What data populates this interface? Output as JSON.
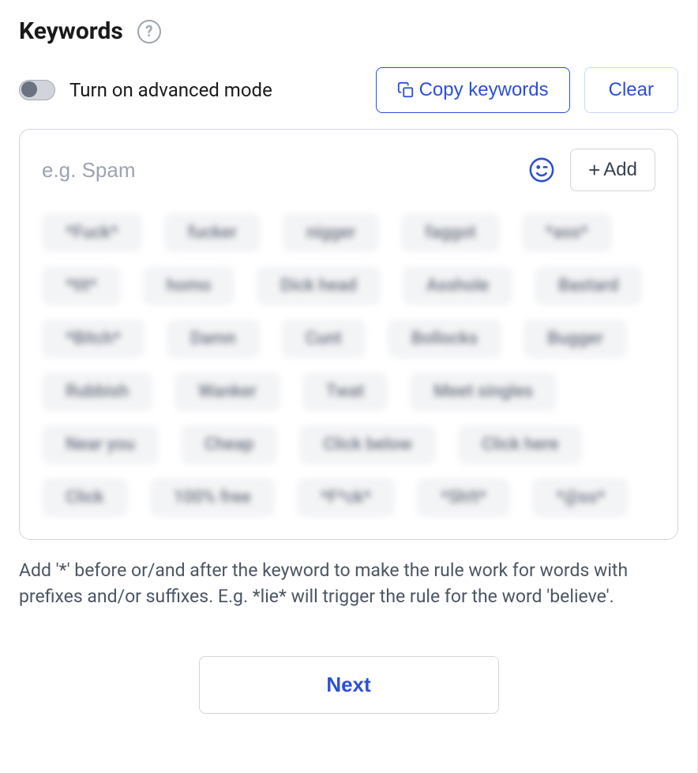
{
  "header": {
    "title": "Keywords",
    "help_glyph": "?"
  },
  "toggle": {
    "label": "Turn on advanced mode",
    "on": false
  },
  "actions": {
    "copy_label": "Copy keywords",
    "clear_label": "Clear"
  },
  "input": {
    "placeholder": "e.g. Spam",
    "add_label": "Add"
  },
  "tags": [
    "*Fuck*",
    "fucker",
    "nigger",
    "faggot",
    "*ass*",
    "*tit*",
    "homo",
    "Dick head",
    "Asshole",
    "Bastard",
    "*Bitch*",
    "Damn",
    "Cunt",
    "Bollocks",
    "Bugger",
    "Rubbish",
    "Wanker",
    "Twat",
    "Meet singles",
    "Near you",
    "Cheap",
    "Click below",
    "Click here",
    "Click",
    "100% free",
    "*F*ck*",
    "*Sh!t*",
    "*@ss*"
  ],
  "hint": "Add '*' before or/and after the keyword to make the rule work for words with prefixes and/or suffixes. E.g. *lie* will trigger the rule for the word 'believe'.",
  "next_label": "Next"
}
